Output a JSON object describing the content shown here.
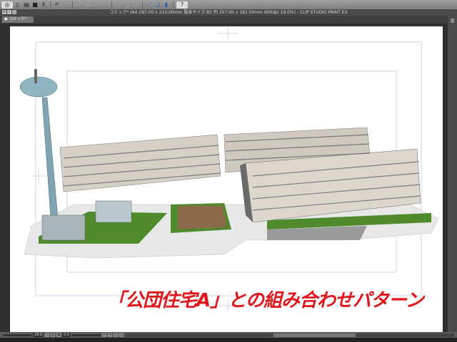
{
  "toolbar": {
    "icons": [
      "clip-studio-logo-icon",
      "new-icon",
      "open-icon",
      "save-icon",
      "undo-icon",
      "redo-icon",
      "transform-icon",
      "select-all-icon",
      "deselect-icon",
      "crop-icon",
      "fill-icon",
      "clear-icon",
      "snap-ruler-icon",
      "snap-grid-icon",
      "snap-guide-icon",
      "help-icon"
    ]
  },
  "titlebar": {
    "title": "コミック* (A4 297.00 x 210.00mm 製本サイズ:B5 判 257.00 x 182.00mm 600dpi 19.0%)  - CLIP STUDIO PAINT EX"
  },
  "tab": {
    "label": "コミック*"
  },
  "canvas": {
    "caption": "「公団住宅A」との組み合わせパターン"
  },
  "status": {
    "zoom": "19.0",
    "rotation": "0.0"
  }
}
